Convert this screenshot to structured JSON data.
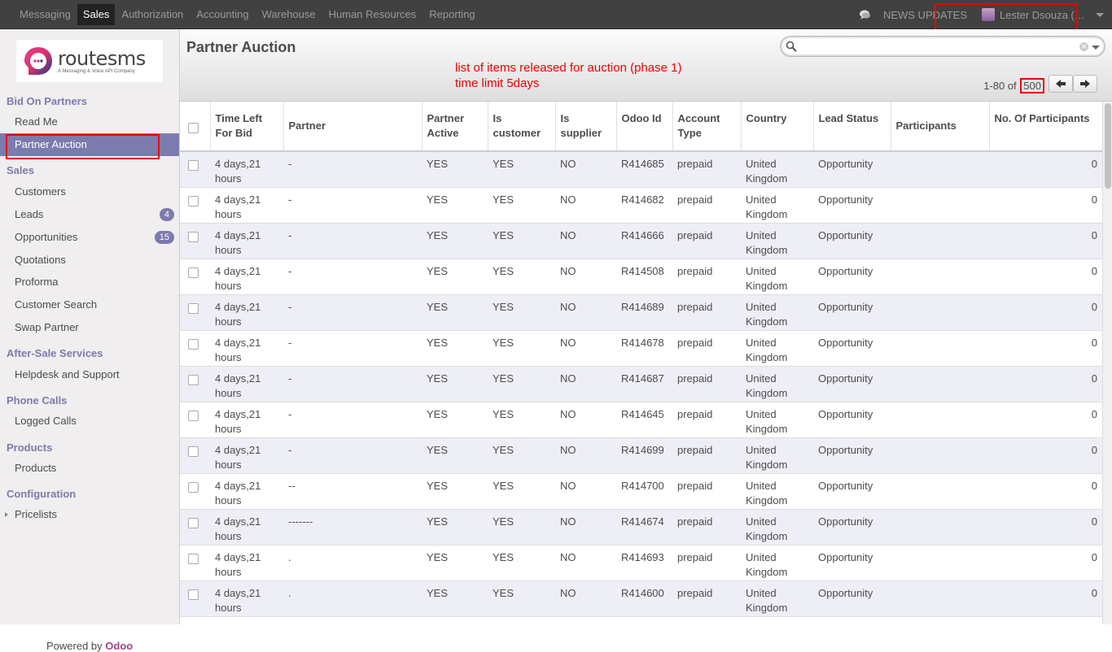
{
  "topbar": {
    "menu": [
      "Messaging",
      "Sales",
      "Authorization",
      "Accounting",
      "Warehouse",
      "Human Resources",
      "Reporting"
    ],
    "active": "Sales",
    "news": "NEWS UPDATES",
    "user": "Lester Dsouza (ROUTE..."
  },
  "logo": {
    "name": "routesms",
    "tagline": "A Messaging & Voice API Company"
  },
  "sidebar": {
    "sections": [
      {
        "title": "Bid On Partners",
        "items": [
          {
            "label": "Read Me"
          },
          {
            "label": "Partner Auction",
            "active": true
          }
        ]
      },
      {
        "title": "Sales",
        "items": [
          {
            "label": "Customers"
          },
          {
            "label": "Leads",
            "badge": "4"
          },
          {
            "label": "Opportunities",
            "badge": "15"
          },
          {
            "label": "Quotations"
          },
          {
            "label": "Proforma"
          },
          {
            "label": "Customer Search"
          },
          {
            "label": "Swap Partner"
          }
        ]
      },
      {
        "title": "After-Sale Services",
        "items": [
          {
            "label": "Helpdesk and Support"
          }
        ]
      },
      {
        "title": "Phone Calls",
        "items": [
          {
            "label": "Logged Calls"
          }
        ]
      },
      {
        "title": "Products",
        "items": [
          {
            "label": "Products"
          }
        ]
      },
      {
        "title": "Configuration",
        "items": [
          {
            "label": "Pricelists",
            "expandable": true
          }
        ]
      }
    ],
    "powered_prefix": "Powered by",
    "powered_brand": "Odoo"
  },
  "header": {
    "title": "Partner Auction",
    "note_line1": "list of items released for auction (phase 1)",
    "note_line2": "time limit 5days",
    "search_value": "",
    "pager_range": "1-80 of",
    "pager_total": "500"
  },
  "table": {
    "columns": [
      "Time Left For Bid",
      "Partner",
      "Partner Active",
      "Is customer",
      "Is supplier",
      "Odoo Id",
      "Account Type",
      "Country",
      "Lead Status",
      "Participants",
      "No. Of Participants"
    ],
    "rows": [
      [
        "4 days,21 hours",
        "-",
        "YES",
        "YES",
        "NO",
        "R414685",
        "prepaid",
        "United Kingdom",
        "Opportunity",
        "",
        "0"
      ],
      [
        "4 days,21 hours",
        "-",
        "YES",
        "YES",
        "NO",
        "R414682",
        "prepaid",
        "United Kingdom",
        "Opportunity",
        "",
        "0"
      ],
      [
        "4 days,21 hours",
        "-",
        "YES",
        "YES",
        "NO",
        "R414666",
        "prepaid",
        "United Kingdom",
        "Opportunity",
        "",
        "0"
      ],
      [
        "4 days,21 hours",
        "-",
        "YES",
        "YES",
        "NO",
        "R414508",
        "prepaid",
        "United Kingdom",
        "Opportunity",
        "",
        "0"
      ],
      [
        "4 days,21 hours",
        "-",
        "YES",
        "YES",
        "NO",
        "R414689",
        "prepaid",
        "United Kingdom",
        "Opportunity",
        "",
        "0"
      ],
      [
        "4 days,21 hours",
        "-",
        "YES",
        "YES",
        "NO",
        "R414678",
        "prepaid",
        "United Kingdom",
        "Opportunity",
        "",
        "0"
      ],
      [
        "4 days,21 hours",
        "-",
        "YES",
        "YES",
        "NO",
        "R414687",
        "prepaid",
        "United Kingdom",
        "Opportunity",
        "",
        "0"
      ],
      [
        "4 days,21 hours",
        "-",
        "YES",
        "YES",
        "NO",
        "R414645",
        "prepaid",
        "United Kingdom",
        "Opportunity",
        "",
        "0"
      ],
      [
        "4 days,21 hours",
        "-",
        "YES",
        "YES",
        "NO",
        "R414699",
        "prepaid",
        "United Kingdom",
        "Opportunity",
        "",
        "0"
      ],
      [
        "4 days,21 hours",
        "--",
        "YES",
        "YES",
        "NO",
        "R414700",
        "prepaid",
        "United Kingdom",
        "Opportunity",
        "",
        "0"
      ],
      [
        "4 days,21 hours",
        "-------",
        "YES",
        "YES",
        "NO",
        "R414674",
        "prepaid",
        "United Kingdom",
        "Opportunity",
        "",
        "0"
      ],
      [
        "4 days,21 hours",
        ".",
        "YES",
        "YES",
        "NO",
        "R414693",
        "prepaid",
        "United Kingdom",
        "Opportunity",
        "",
        "0"
      ],
      [
        "4 days,21 hours",
        ".",
        "YES",
        "YES",
        "NO",
        "R414600",
        "prepaid",
        "United Kingdom",
        "Opportunity",
        "",
        "0"
      ],
      [
        "",
        "",
        "",
        "",
        "",
        "",
        "",
        "",
        "",
        "",
        ""
      ]
    ]
  },
  "colors": {
    "accent": "#7c7bad",
    "topbar": "#414141",
    "annotation": "#ee0000",
    "row_alt": "#eeeef6"
  },
  "icons": [
    "chat-icon",
    "avatar",
    "search-icon",
    "clear-icon",
    "prev-arrow-icon",
    "next-arrow-icon",
    "gavel-icon",
    "checkbox"
  ]
}
